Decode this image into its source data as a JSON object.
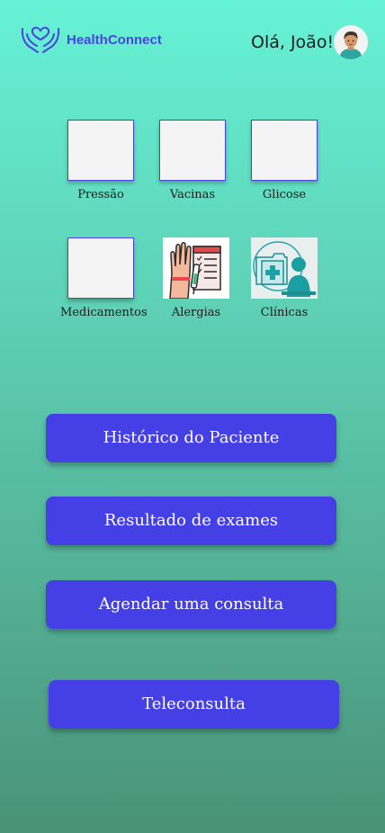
{
  "header": {
    "brand": "HealthConnect",
    "greeting": "Olá, João!"
  },
  "tiles": [
    {
      "label": "Pressão"
    },
    {
      "label": "Vacinas"
    },
    {
      "label": "Glicose"
    },
    {
      "label": "Medicamentos"
    },
    {
      "label": "Alergias",
      "icon": "allergy-test-icon"
    },
    {
      "label": "Clínicas",
      "icon": "clinic-doctor-icon"
    }
  ],
  "buttons": {
    "history": "Histórico do Paciente",
    "exams": "Resultado de exames",
    "schedule": "Agendar uma consulta",
    "teleconsult": "Teleconsulta"
  },
  "colors": {
    "accent": "#453fe6",
    "brand_text": "#4a43e0",
    "bg_top": "#66f2d6",
    "bg_bottom": "#4a9278"
  }
}
